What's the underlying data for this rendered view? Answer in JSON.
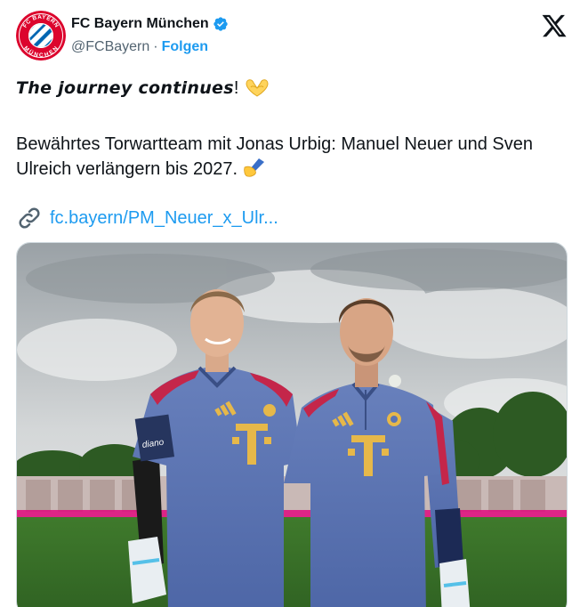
{
  "account": {
    "display_name": "FC Bayern München",
    "handle": "@FCBayern",
    "separator": "·",
    "follow_label": "Folgen",
    "avatar_icon": "fc-bayern-crest-icon",
    "crest_text_top": "FC BAYERN",
    "crest_text_bottom": "MÜNCHEN",
    "verified_icon": "verified-badge-icon",
    "brand_logo": "x-logo-icon"
  },
  "tweet": {
    "line1_italic": "The journey continues",
    "line1_suffix": "!",
    "line1_emoji": "🫶",
    "paragraph": "Bewährtes Torwartteam mit Jonas Urbig: Manuel Neuer und Sven Ulreich verlängern bis 2027.",
    "paragraph_emoji": "✍️",
    "link_text": "fc.bayern/PM_Neuer_x_Ulr...",
    "link_icon": "link-icon"
  },
  "media": {
    "jersey_logo": "T",
    "sponsor_text": "diano"
  },
  "colors": {
    "link": "#1d9bf0",
    "secondary_text": "#536471",
    "bayern_red": "#dc052d",
    "bayern_blue": "#0066b2",
    "jersey": "#5a74b4"
  }
}
